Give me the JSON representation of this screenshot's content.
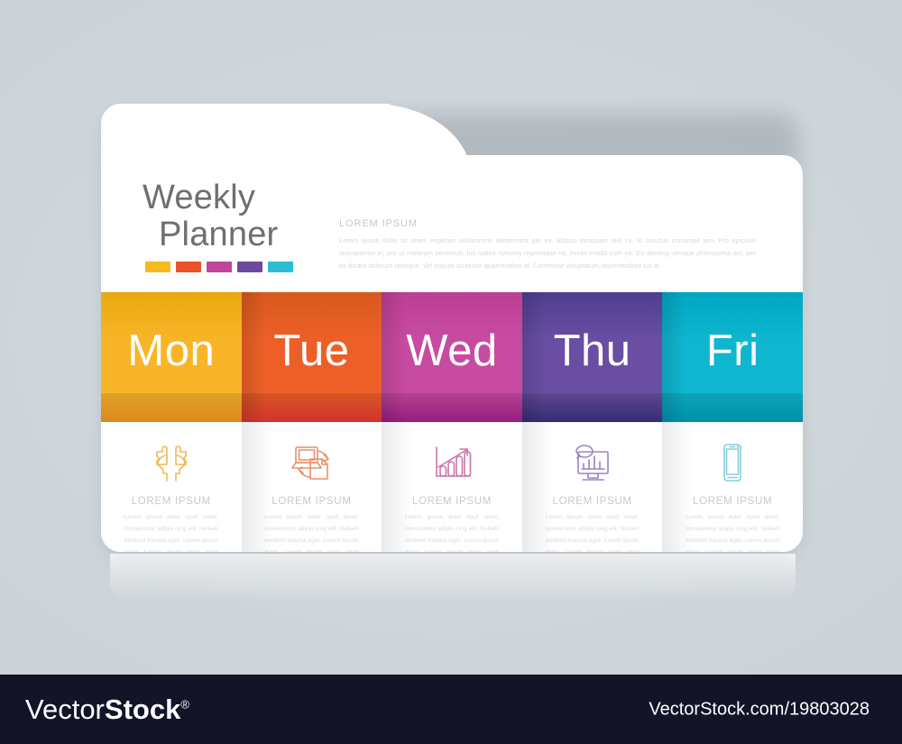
{
  "background_color": "#ccd3d8",
  "header": {
    "title_line1": "Weekly",
    "title_line2": "Planner",
    "swatch_colors": [
      "#f5b921",
      "#ea5229",
      "#c0469b",
      "#6d4aa0",
      "#2cbcd4"
    ],
    "kicker": "LOREM IPSUM",
    "body": "Lorem ipsum dolor sit amet, explicari adolescens abhorreant per ex. Aliquip tamquam mel cu, id sanctus corrumpit vim. Pro epicurei suscipiantur ei, pro ut maiorum persecuti. Ius iudico nonumy reprimique no, modo eruditi cum ne. Cu doming utroque philosophia qui, per ex dicant dolorum remique. Vel populo quaestio quaerendum id. Commune voluptatum reprehendunt ius te."
  },
  "days": [
    {
      "label": "Mon",
      "color_top": "#e9a80f",
      "color_mid": "#f9b528",
      "color_bottom": "#f79a22",
      "icon": "two-heads-puzzle-icon",
      "icon_color": "#edbb57",
      "title": "LOREM IPSUM",
      "body": "Lorem ipsum dolor opsit amet, consectetur adipis cing elit. Nullam eleifend trauma eget. Lorem ipsum dolor. Lorem ipsum dolor opsit amet, con-Nullam eleifend."
    },
    {
      "label": "Tue",
      "color_top": "#d75a1e",
      "color_mid": "#ee5f28",
      "color_bottom": "#ed3a33",
      "icon": "computer-document-exchange-icon",
      "icon_color": "#e8906c",
      "title": "LOREM IPSUM",
      "body": "Lorem ipsum dolor opsit amet, consectetur adipis cing elit. Nullam eleifend trauma eget. Lorem ipsum dolor. Lorem ipsum dolor opsit amet, con-Nullam eleifend."
    },
    {
      "label": "Wed",
      "color_top": "#bc3f94",
      "color_mid": "#c74ba0",
      "color_bottom": "#a9218e",
      "icon": "bar-chart-growth-icon",
      "icon_color": "#cc74ab",
      "title": "LOREM IPSUM",
      "body": "Lorem ipsum dolor opsit amet, consectetur adipis cing elit. Nullam eleifend trauma eget. Lorem ipsum dolor. Lorem ipsum dolor opsit amet, con-Nullam eleifend."
    },
    {
      "label": "Thu",
      "color_top": "#4e3f8e",
      "color_mid": "#6a4ea4",
      "color_bottom": "#3c3183",
      "icon": "monitor-chart-speech-icon",
      "icon_color": "#9a84c0",
      "title": "LOREM IPSUM",
      "body": "Lorem ipsum dolor opsit amet, consectetur adipis cing elit. Nullam eleifend trauma eget. Lorem ipsum dolor. Lorem ipsum dolor opsit amet, con-Nullam eleifend."
    },
    {
      "label": "Fri",
      "color_top": "#00a7c4",
      "color_mid": "#0fb6cf",
      "color_bottom": "#00a2bd",
      "icon": "smartphone-icon",
      "icon_color": "#85cfdd",
      "title": "LOREM IPSUM",
      "body": "Lorem ipsum dolor opsit amet, consectetur adipis cing elit. Nullam eleifend trauma eget. Lorem ipsum dolor. Lorem ipsum dolor opsit amet, con-Nullam eleifend."
    }
  ],
  "footer": {
    "logo_thin": "Vector",
    "logo_bold": "Stock",
    "logo_registered": "®",
    "url": "VectorStock.com/19803028",
    "background_color": "#131428"
  }
}
